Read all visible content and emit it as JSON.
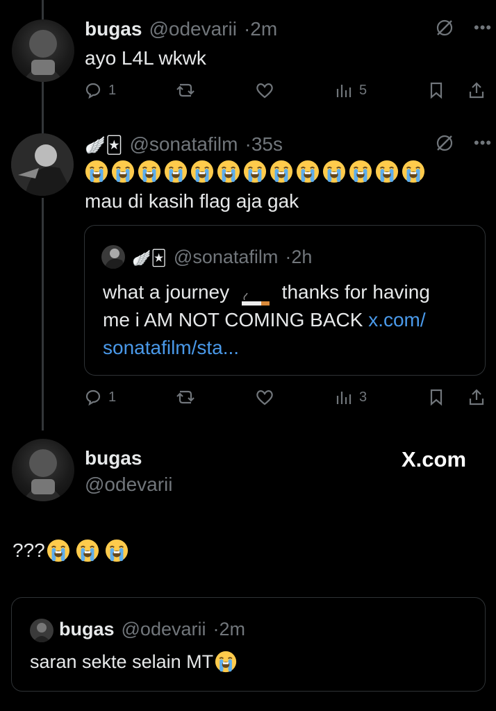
{
  "thread": [
    {
      "name": "bugas",
      "handle": "@odevarii",
      "time": "2m",
      "text": "ayo L4L wkwk",
      "stats": {
        "replies": "1",
        "views": "5"
      }
    },
    {
      "name_emoji": "🪽🃏",
      "handle": "@sonatafilm",
      "time": "35s",
      "emoji_line_count": 13,
      "text": "mau di kasih flag aja gak",
      "quote": {
        "name_emoji": "🪽🃏",
        "handle": "@sonatafilm",
        "time": "2h",
        "text_line1_a": "what a journey",
        "text_line1_b": "thanks for having",
        "text_line2": "me i AM NOT COMING BACK",
        "link_part1": "x.com/",
        "link_part2": "sonatafilm/sta..."
      },
      "stats": {
        "replies": "1",
        "views": "3"
      }
    }
  ],
  "main_post": {
    "name": "bugas",
    "handle": "@odevarii",
    "site": "X.com",
    "text": "???",
    "quote": {
      "name": "bugas",
      "handle": "@odevarii",
      "time": "2m",
      "text": "saran sekte selain MT"
    }
  },
  "icons": {
    "reply": "reply-icon",
    "repost": "repost-icon",
    "like": "heart-icon",
    "views": "views-icon",
    "bookmark": "bookmark-icon",
    "share": "share-icon",
    "grok": "grok-icon",
    "more": "more-icon",
    "emoji": "loudly-crying-face"
  },
  "colors": {
    "background": "#000000",
    "text": "#e7e9ea",
    "muted": "#71767b",
    "link": "#4a99e9",
    "border": "#2f3336"
  }
}
